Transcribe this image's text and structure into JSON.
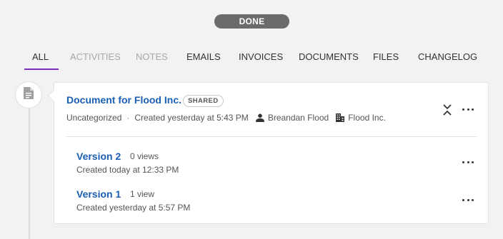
{
  "status": {
    "label": "DONE"
  },
  "tabs": [
    {
      "label": "ALL",
      "state": "active"
    },
    {
      "label": "ACTIVITIES",
      "state": "disabled"
    },
    {
      "label": "NOTES",
      "state": "disabled"
    },
    {
      "label": "EMAILS",
      "state": "normal"
    },
    {
      "label": "INVOICES",
      "state": "normal"
    },
    {
      "label": "DOCUMENTS",
      "state": "normal"
    },
    {
      "label": "FILES",
      "state": "normal"
    },
    {
      "label": "CHANGELOG",
      "state": "normal"
    }
  ],
  "document": {
    "title": "Document for Flood Inc.",
    "badge": "SHARED",
    "category": "Uncategorized",
    "separator": "·",
    "created": "Created yesterday at 5:43 PM",
    "owner": "Breandan Flood",
    "company": "Flood Inc.",
    "versions": [
      {
        "name": "Version 2",
        "views": "0 views",
        "created": "Created today at 12:33 PM"
      },
      {
        "name": "Version 1",
        "views": "1 view",
        "created": "Created yesterday at 5:57 PM"
      }
    ]
  },
  "colors": {
    "accent": "#7b2fbf",
    "link": "#1a5fb4",
    "pill": "#6b6b6b",
    "background": "#f2f2f2"
  },
  "icons": {
    "document": "document-icon",
    "person": "person-icon",
    "company": "building-icon",
    "collapse": "collapse-icon",
    "more": "more-horizontal-icon"
  }
}
